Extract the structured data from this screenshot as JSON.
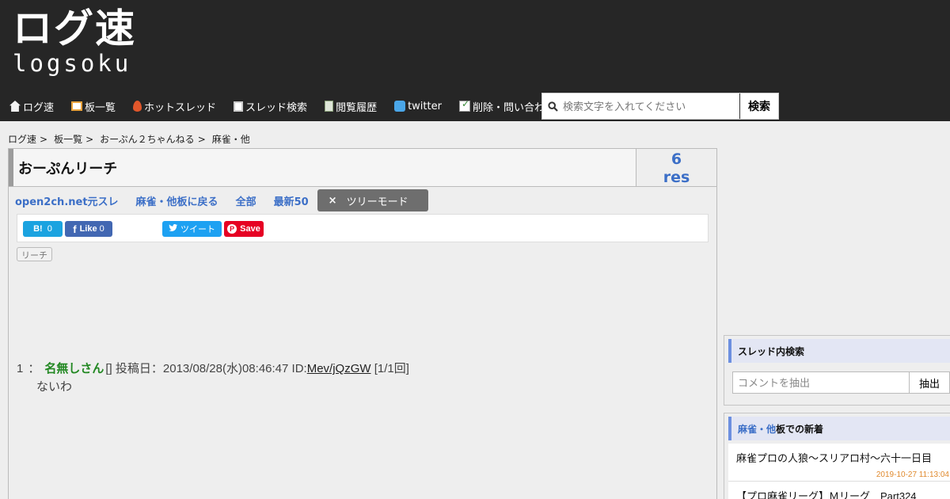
{
  "header": {
    "logo_main": "ログ速",
    "logo_sub": "logsoku",
    "nav": [
      {
        "label": "ログ速",
        "icon": "home-icon"
      },
      {
        "label": "板一覧",
        "icon": "board-icon"
      },
      {
        "label": "ホットスレッド",
        "icon": "fire-icon"
      },
      {
        "label": "スレッド検索",
        "icon": "search-doc-icon"
      },
      {
        "label": "閲覧履歴",
        "icon": "history-icon"
      },
      {
        "label": "twitter",
        "icon": "twitter-icon"
      },
      {
        "label": "削除・問い合わせ",
        "icon": "delete-request-icon"
      }
    ],
    "search_placeholder": "検索文字を入れてください",
    "search_button": "検索"
  },
  "breadcrumb": [
    {
      "label": "ログ速",
      "sep": ">"
    },
    {
      "label": "板一覧",
      "sep": ">"
    },
    {
      "label": "おーぷん２ちゃんねる",
      "sep": ">"
    },
    {
      "label": "麻雀・他",
      "sep": ""
    }
  ],
  "thread": {
    "title": "おーぷんリーチ",
    "res_count": "6",
    "res_label": "res",
    "links": [
      "open2ch.net元スレ",
      "麻雀・他板に戻る",
      "全部",
      "最新50"
    ],
    "tree_mode_label": "ツリーモード",
    "tree_mode_close": "×",
    "tag": "リーチ"
  },
  "share": {
    "hatena_label": "B!",
    "hatena_count": "0",
    "fb_label": "Like",
    "fb_count": "0",
    "tweet_label": "ツイート",
    "pin_label": "Save"
  },
  "posts": [
    {
      "num": "1",
      "sep": "：",
      "name": "名無しさん",
      "name_suffix": "[]",
      "date_prefix": "投稿日：",
      "date": "2013/08/28(水)08:46:47",
      "id_prefix": "ID:",
      "id": "Mev/jQzGW",
      "count": "[1/1回]",
      "body": "ないわ"
    }
  ],
  "sidebar": {
    "search_title": "スレッド内検索",
    "comment_placeholder": "コメントを抽出",
    "comment_button": "抽出",
    "news_board": "麻雀・他",
    "news_title_suffix": "板での新着",
    "news": [
      {
        "title": "麻雀プロの人狼～スリアロ村～六十一日目",
        "date": "2019-10-27 11:13:04"
      },
      {
        "title": "【プロ麻雀リーグ】Ｍリーグ　Part324",
        "date": ""
      }
    ]
  },
  "colors": {
    "header_bg": "#262626",
    "link_blue": "#3c6fc7",
    "name_green": "#228822",
    "date_orange": "#e08a2e"
  }
}
